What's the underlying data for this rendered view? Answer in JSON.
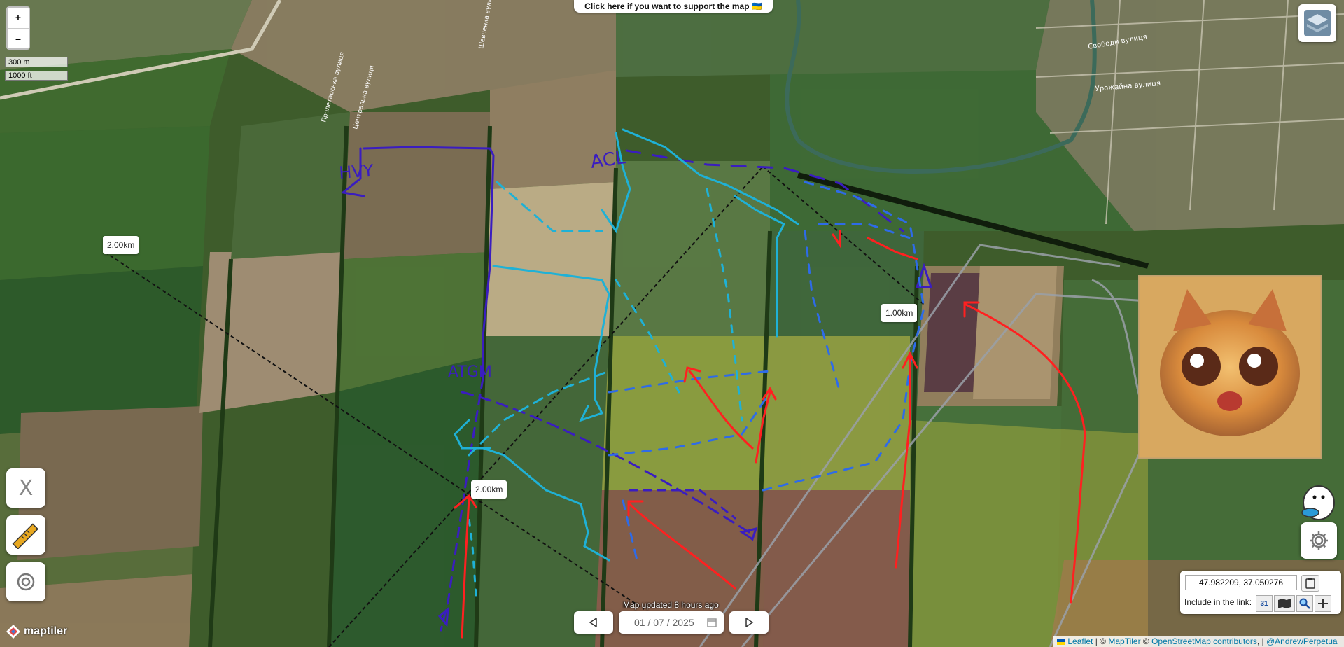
{
  "zoom": {
    "in_label": "+",
    "out_label": "–"
  },
  "scale": {
    "metric": "300 m",
    "imperial": "1000 ft"
  },
  "support_banner": "Click here if you want to support the map 🇺🇦",
  "map_labels": {
    "unit_hvy": "HVY",
    "unit_acl": "ACL",
    "unit_atgm": "ATGM",
    "street_1": "Свободи вулиця",
    "street_2": "Урожайна вулиця",
    "street_3": "Пролетарська вулиця",
    "street_4": "Центральна вулиця",
    "street_5": "Шевченка вулиця"
  },
  "distances": {
    "d1": "2.00km",
    "d2": "2.00km",
    "d3": "1.00km"
  },
  "tools": {
    "x_label": "X"
  },
  "coordinates": {
    "value": "47.982209, 37.050276"
  },
  "include_link_label": "Include in the link:",
  "include_buttons": {
    "calendar_day": "31"
  },
  "map_updated": "Map updated 8 hours ago",
  "date": {
    "value": "01 / 07 / 2025"
  },
  "brand": "maptiler",
  "attribution": {
    "leaflet": "Leaflet",
    "sep1": " | © ",
    "maptiler": "MapTiler",
    "sep2": " © ",
    "osm": "OpenStreetMap contributors",
    "sep3": ", | ",
    "author": "@AndrewPerpetua"
  },
  "colors": {
    "blue_team": "#1fb1d6",
    "dark_team": "#3a1dc0",
    "dashed_blue": "#2e6be8",
    "red_team": "#ff2020",
    "yellow_zone": "#d8d040",
    "red_zone": "#d26060"
  }
}
